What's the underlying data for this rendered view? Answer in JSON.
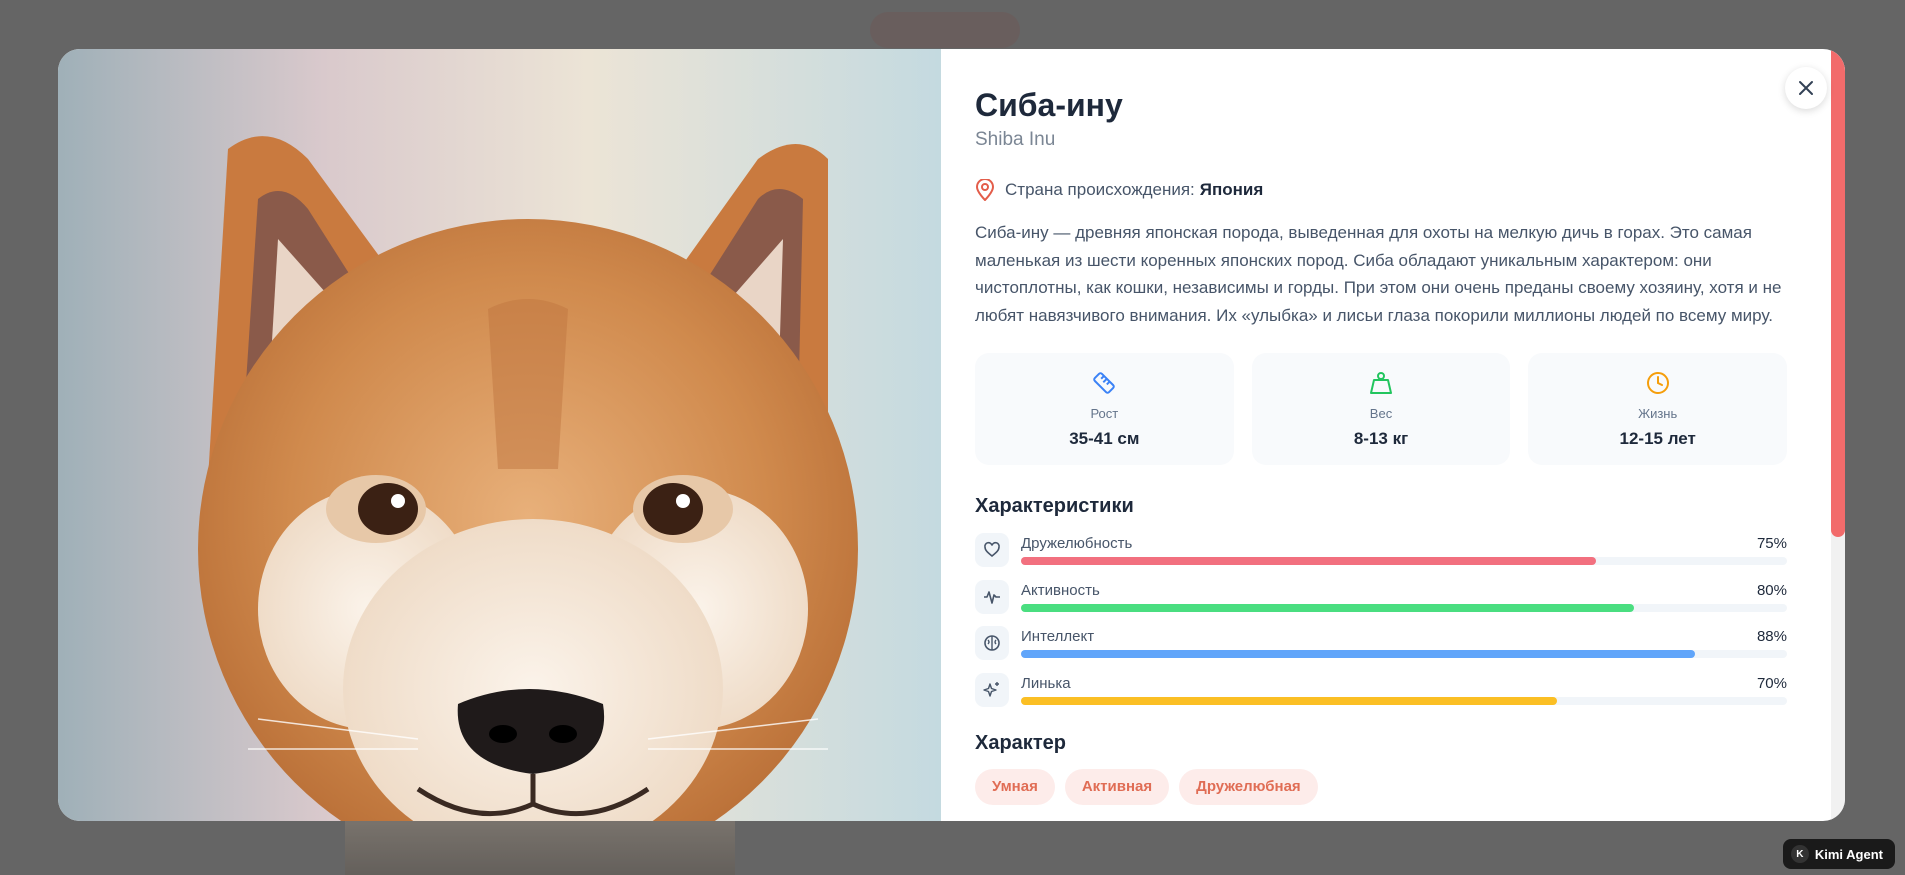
{
  "breed": {
    "title": "Сиба-ину",
    "subtitle": "Shiba Inu",
    "origin_label": "Страна происхождения:",
    "origin_value": "Япония",
    "description": "Сиба-ину — древняя японская порода, выведенная для охоты на мелкую дичь в горах. Это самая маленькая из шести коренных японских пород. Сиба обладают уникальным характером: они чистоплотны, как кошки, независимы и горды. При этом они очень преданы своему хозяину, хотя и не любят навязчивого внимания. Их «улыбка» и лисьи глаза покорили миллионы людей по всему миру."
  },
  "stats": [
    {
      "icon": "ruler-icon",
      "label": "Рост",
      "value": "35-41 см",
      "color": "#3b82f6"
    },
    {
      "icon": "weight-icon",
      "label": "Вес",
      "value": "8-13 кг",
      "color": "#22c55e"
    },
    {
      "icon": "clock-icon",
      "label": "Жизнь",
      "value": "12-15 лет",
      "color": "#f59e0b"
    }
  ],
  "characteristics": {
    "heading": "Характеристики",
    "items": [
      {
        "icon": "heart-icon",
        "label": "Дружелюбность",
        "percent_text": "75%",
        "value": 75,
        "color": "#f2707f"
      },
      {
        "icon": "activity-icon",
        "label": "Активность",
        "percent_text": "80%",
        "value": 80,
        "color": "#4ade80"
      },
      {
        "icon": "brain-icon",
        "label": "Интеллект",
        "percent_text": "88%",
        "value": 88,
        "color": "#60a5fa"
      },
      {
        "icon": "sparkle-icon",
        "label": "Линька",
        "percent_text": "70%",
        "value": 70,
        "color": "#fbbf24"
      }
    ]
  },
  "character": {
    "heading": "Характер",
    "tags": [
      "Умная",
      "Активная",
      "Дружелюбная"
    ]
  },
  "badge": {
    "label": "Kimi Agent",
    "icon_letter": "K"
  },
  "colors": {
    "accent": "#f26b6b",
    "tag_text": "#e06d55",
    "tag_bg": "#fdecea"
  }
}
